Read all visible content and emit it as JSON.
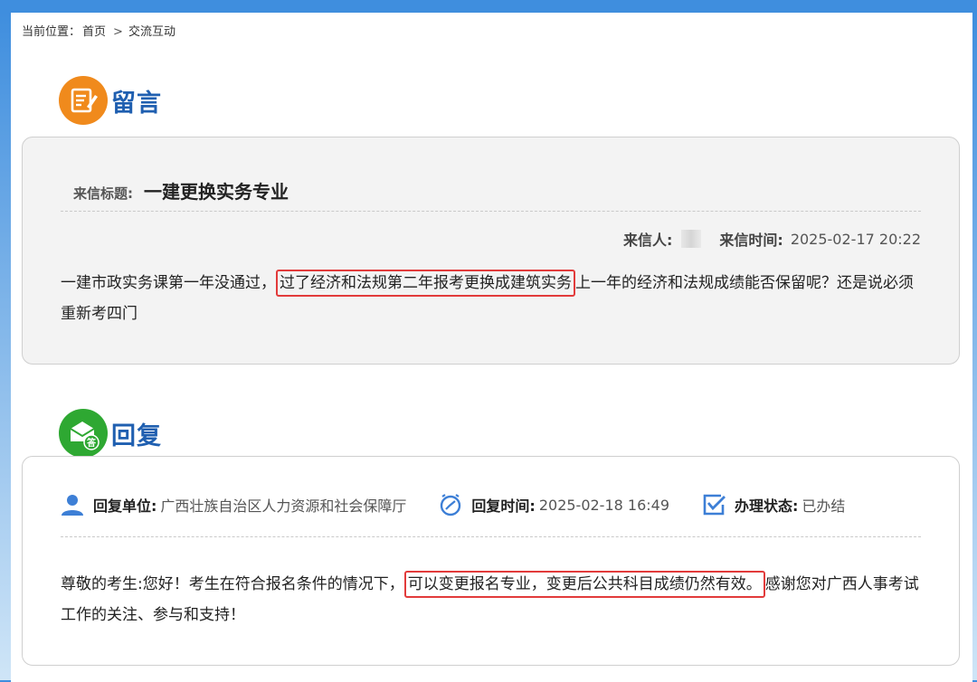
{
  "breadcrumb": {
    "prefix": "当前位置：",
    "home": "首页",
    "separator": ">",
    "current": "交流互动"
  },
  "message": {
    "section_title": "留言",
    "subject_label": "来信标题:",
    "subject": "一建更换实务专业",
    "sender_label": "来信人:",
    "time_label": "来信时间:",
    "time": "2025-02-17 20:22",
    "body_before": "一建市政实务课第一年没通过，",
    "body_highlight": "过了经济和法规第二年报考更换成建筑实务",
    "body_after": "上一年的经济和法规成绩能否保留呢？还是说必须重新考四门"
  },
  "reply": {
    "section_title": "回复",
    "unit_label": "回复单位:",
    "unit": "广西壮族自治区人力资源和社会保障厅",
    "time_label": "回复时间:",
    "time": "2025-02-18 16:49",
    "status_label": "办理状态:",
    "status": "已办结",
    "body_before": "尊敬的考生:您好！考生在符合报名条件的情况下，",
    "body_highlight": "可以变更报名专业，变更后公共科目成绩仍然有效。",
    "body_after": "感谢您对广西人事考试工作的关注、参与和支持！"
  },
  "colors": {
    "accent_blue": "#1f5fb0",
    "message_icon": "#f08a1c",
    "reply_icon": "#2ea832",
    "highlight_border": "#e23b3b"
  },
  "icons": {
    "message": "edit-note-icon",
    "reply": "envelope-answer-icon",
    "unit": "user-icon",
    "time": "clock-icon",
    "status": "check-square-icon"
  }
}
